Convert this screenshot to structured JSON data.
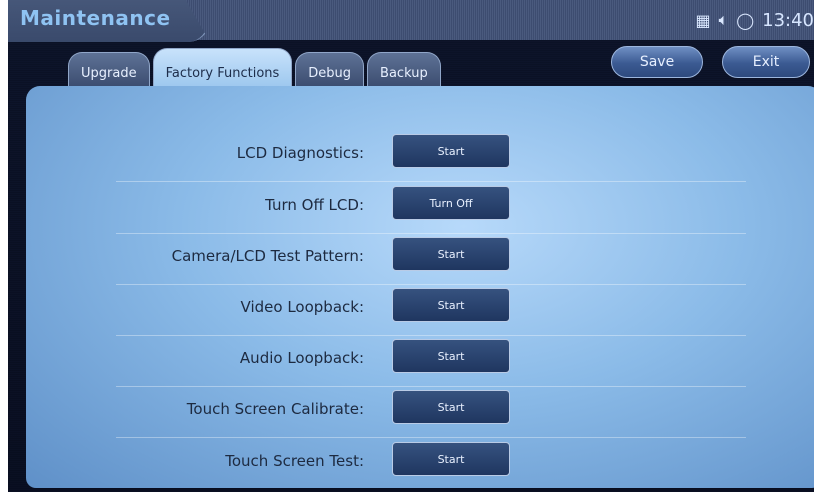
{
  "header": {
    "title": "Maintenance",
    "status_icons": [
      "keyboard-icon",
      "speaker-icon",
      "sync-icon"
    ],
    "time": "13:40"
  },
  "tabs": [
    {
      "label": "Upgrade",
      "active": false
    },
    {
      "label": "Factory Functions",
      "active": true
    },
    {
      "label": "Debug",
      "active": false
    },
    {
      "label": "Backup",
      "active": false
    }
  ],
  "actions": {
    "save_label": "Save",
    "exit_label": "Exit"
  },
  "rows": [
    {
      "label": "LCD Diagnostics:",
      "button": "Start"
    },
    {
      "label": "Turn Off LCD:",
      "button": "Turn Off"
    },
    {
      "label": "Camera/LCD Test Pattern:",
      "button": "Start"
    },
    {
      "label": "Video Loopback:",
      "button": "Start"
    },
    {
      "label": "Audio Loopback:",
      "button": "Start"
    },
    {
      "label": "Touch Screen Calibrate:",
      "button": "Start"
    },
    {
      "label": "Touch Screen Test:",
      "button": "Start"
    }
  ],
  "colors": {
    "title_text": "#8fc3f2",
    "panel_light": "#b7d9fa",
    "button_dark": "#1f3660"
  }
}
